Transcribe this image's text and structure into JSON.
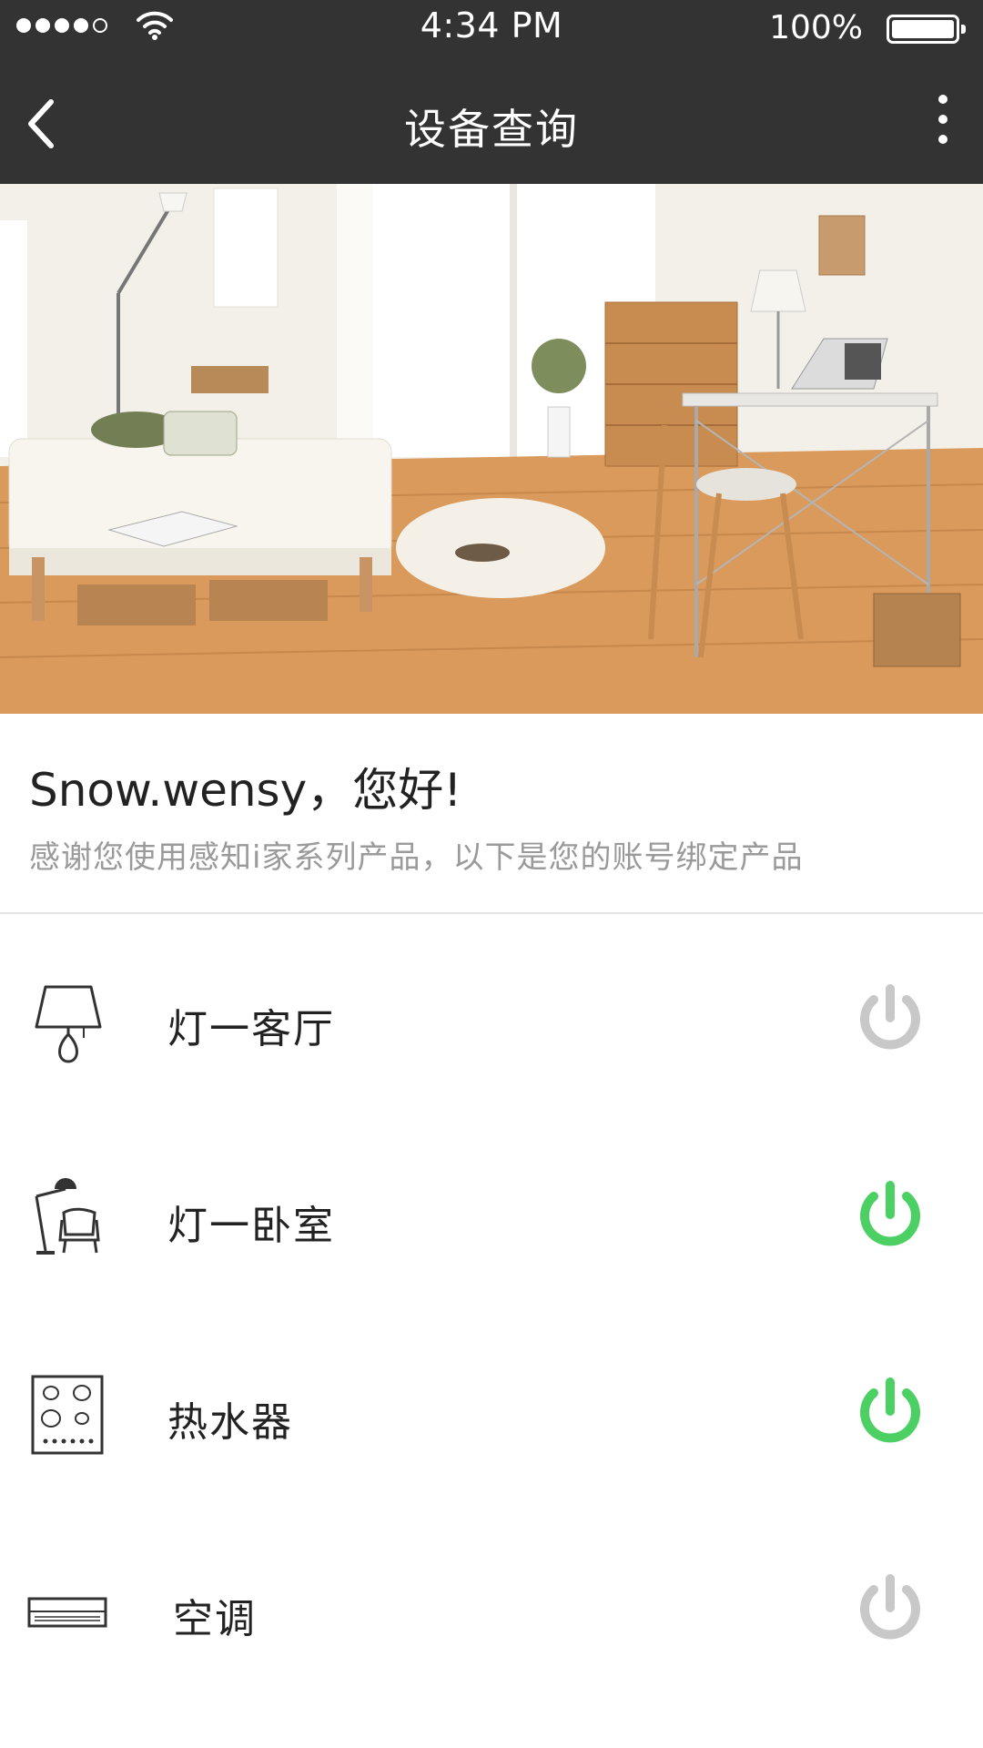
{
  "status_bar": {
    "time": "4:34 PM",
    "battery": "100%",
    "signal_icon": "signal-icon",
    "wifi_icon": "wifi-icon",
    "battery_icon": "battery-icon"
  },
  "nav": {
    "title": "设备查询",
    "back_icon": "chevron-left-icon",
    "more_icon": "more-vertical-icon"
  },
  "hero": {
    "image": "room-photo"
  },
  "greeting": {
    "name_line": "Snow.wensy，您好!",
    "subtitle": "感谢您使用感知i家系列产品，以下是您的账号绑定产品"
  },
  "devices": [
    {
      "label": "灯一客厅",
      "icon": "lamp-icon",
      "power_on": false
    },
    {
      "label": "灯一卧室",
      "icon": "floor-lamp-chair-icon",
      "power_on": true
    },
    {
      "label": "热水器",
      "icon": "water-heater-icon",
      "power_on": true
    },
    {
      "label": "空调",
      "icon": "air-conditioner-icon",
      "power_on": false
    }
  ],
  "colors": {
    "nav_bg": "#333333",
    "power_on": "#4cd064",
    "power_off": "#c8c8c8",
    "subtitle_text": "#9a9a9a"
  }
}
